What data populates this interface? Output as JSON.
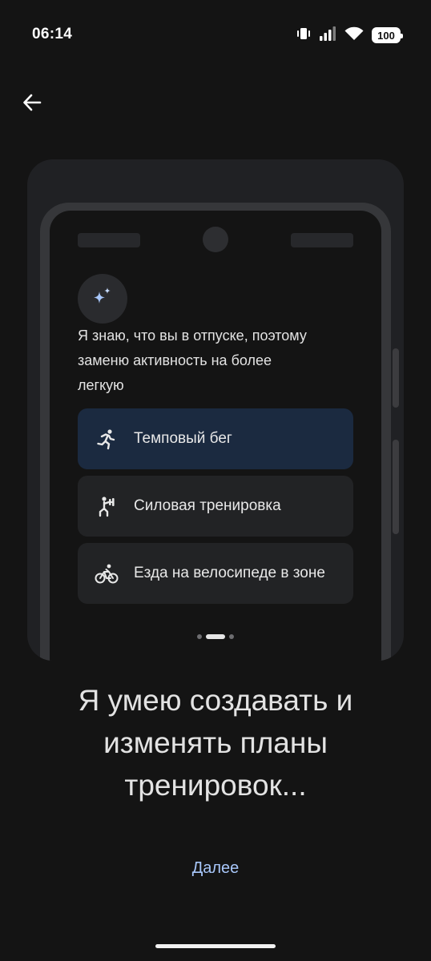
{
  "status_bar": {
    "time": "06:14",
    "battery": "100"
  },
  "navigation": {
    "back_icon": "arrow-back-icon"
  },
  "illustration": {
    "avatar_icon": "sparkle-icon",
    "message": "Я знаю, что вы в отпуске, поэтому\nзаменю активность на более\nлегкую",
    "workouts": [
      {
        "label": "Темповый бег",
        "icon": "running-icon",
        "selected": true
      },
      {
        "label": "Силовая тренировка",
        "icon": "strength-training-icon",
        "selected": false
      },
      {
        "label": "Езда на велосипеде в зоне",
        "icon": "cycling-icon",
        "selected": false
      }
    ],
    "pager": {
      "count": 3,
      "active_index": 1
    }
  },
  "title": "Я умею создавать и\nизменять планы\nтренировок...",
  "next_label": "Далее",
  "colors": {
    "background": "#141414",
    "accent": "#a8c7fa",
    "selected_card": "#1b2a40",
    "card": "#222325"
  }
}
